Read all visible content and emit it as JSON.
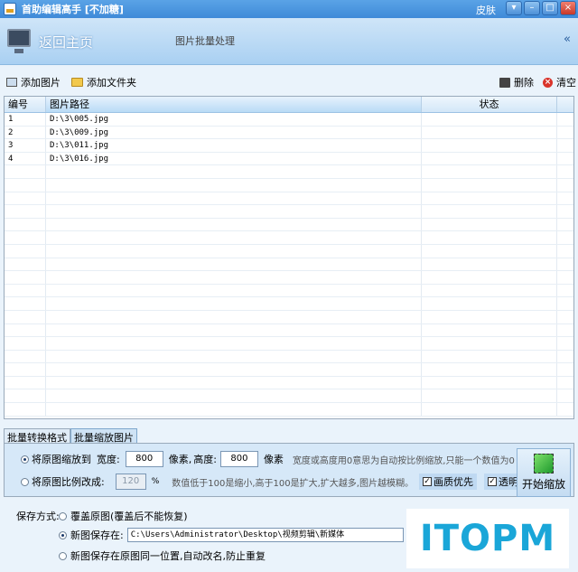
{
  "titlebar": {
    "title": "首助编辑高手 [不加糖]",
    "skin": "皮肤",
    "btn_menu": "▾",
    "btn_min": "–",
    "btn_max": "□",
    "btn_close": "×"
  },
  "header": {
    "back_home": "返回主页",
    "subtitle": "图片批量处理",
    "collapse": "«"
  },
  "toolbar": {
    "add_image": "添加图片",
    "add_folder": "添加文件夹",
    "delete": "删除",
    "clear": "清空"
  },
  "table": {
    "columns": [
      "编号",
      "图片路径",
      "状态"
    ],
    "rows": [
      {
        "no": "1",
        "path": "D:\\3\\005.jpg",
        "status": ""
      },
      {
        "no": "2",
        "path": "D:\\3\\009.jpg",
        "status": ""
      },
      {
        "no": "3",
        "path": "D:\\3\\011.jpg",
        "status": ""
      },
      {
        "no": "4",
        "path": "D:\\3\\016.jpg",
        "status": ""
      }
    ]
  },
  "tabs": [
    "批量转换格式",
    "批量缩放图片"
  ],
  "resize": {
    "opt1_label": "将原图缩放到",
    "width_label": "宽度:",
    "width_value": "800",
    "px1": "像素,",
    "height_label": "高度:",
    "height_value": "800",
    "px2": "像素",
    "hint1": "宽度或高度用0意思为自动按比例缩放,只能一个数值为0",
    "opt2_label": "将原图比例改成:",
    "ratio_value": "120",
    "percent": "%",
    "hint2": "数值低于100是缩小,高于100是扩大,扩大越多,图片越模糊。",
    "quality_label": "画质优先",
    "transparent_label": "透明优先",
    "start_label": "开始缩放"
  },
  "save": {
    "label": "保存方式:",
    "opt_overwrite": "覆盖原图(覆盖后不能恢复)",
    "opt_new_label": "新图保存在:",
    "new_path": "C:\\Users\\Administrator\\Desktop\\视频剪辑\\新媒体",
    "opt_same": "新图保存在原图同一位置,自动改名,防止重复"
  },
  "watermark": "ITOPM"
}
